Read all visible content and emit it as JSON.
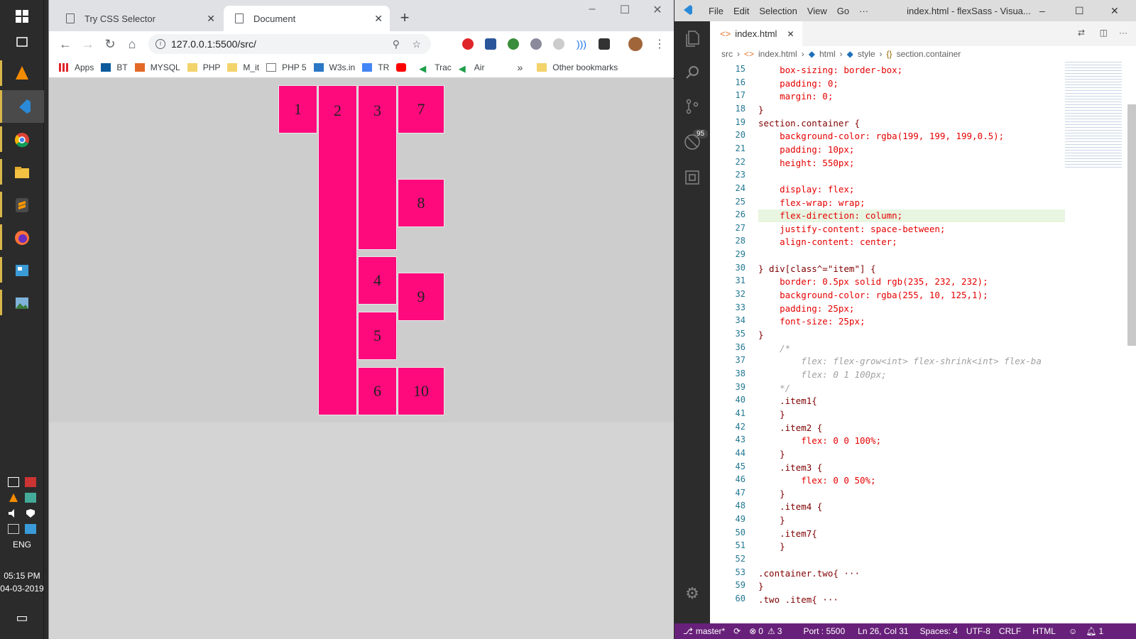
{
  "taskbar": {
    "lang": "ENG",
    "time": "05:15 PM",
    "date": "04-03-2019"
  },
  "chrome": {
    "tabs": [
      {
        "title": "Try CSS Selector"
      },
      {
        "title": "Document"
      }
    ],
    "url": "127.0.0.1:5500/src/",
    "bookmarks": [
      "Apps",
      "BT",
      "MYSQL",
      "PHP",
      "M_it",
      "PHP 5",
      "W3s.in",
      "TR",
      "",
      "Trac",
      "Air"
    ],
    "other_bookmarks": "Other bookmarks",
    "overflow": "»"
  },
  "page": {
    "items": [
      "1",
      "2",
      "3",
      "7",
      "8",
      "4",
      "9",
      "5",
      "6",
      "10"
    ],
    "colors": {
      "item_bg": "#ff0a7d",
      "container_bg": "#cdcdcd"
    }
  },
  "vscode": {
    "menu": [
      "File",
      "Edit",
      "Selection",
      "View",
      "Go",
      "···"
    ],
    "title": "index.html - flexSass - Visua...",
    "tab": "index.html",
    "breadcrumb": [
      "src",
      "index.html",
      "html",
      "style",
      "section.container"
    ],
    "scm_badge": "95",
    "lines": [
      {
        "n": "15",
        "t": "    box-sizing: border-box;"
      },
      {
        "n": "16",
        "t": "    padding: 0;"
      },
      {
        "n": "17",
        "t": "    margin: 0;"
      },
      {
        "n": "18",
        "t": "}"
      },
      {
        "n": "19",
        "t": "section.container {"
      },
      {
        "n": "20",
        "t": "    background-color: rgba(199, 199, 199,0.5);"
      },
      {
        "n": "21",
        "t": "    padding: 10px;"
      },
      {
        "n": "22",
        "t": "    height: 550px;"
      },
      {
        "n": "23",
        "t": ""
      },
      {
        "n": "24",
        "t": "    display: flex;"
      },
      {
        "n": "25",
        "t": "    flex-wrap: wrap;"
      },
      {
        "n": "26",
        "t": "    flex-direction: column;"
      },
      {
        "n": "27",
        "t": "    justify-content: space-between;"
      },
      {
        "n": "28",
        "t": "    align-content: center;"
      },
      {
        "n": "29",
        "t": ""
      },
      {
        "n": "30",
        "t": "} div[class^=\"item\"] {"
      },
      {
        "n": "31",
        "t": "    border: 0.5px solid rgb(235, 232, 232);"
      },
      {
        "n": "32",
        "t": "    background-color: rgba(255, 10, 125,1);"
      },
      {
        "n": "33",
        "t": "    padding: 25px;"
      },
      {
        "n": "34",
        "t": "    font-size: 25px;"
      },
      {
        "n": "35",
        "t": "}"
      },
      {
        "n": "36",
        "t": "    /*"
      },
      {
        "n": "37",
        "t": "        flex: flex-grow<int> flex-shrink<int> flex-ba"
      },
      {
        "n": "38",
        "t": "        flex: 0 1 100px;"
      },
      {
        "n": "39",
        "t": "    */"
      },
      {
        "n": "40",
        "t": "    .item1{"
      },
      {
        "n": "41",
        "t": "    }"
      },
      {
        "n": "42",
        "t": "    .item2 {"
      },
      {
        "n": "43",
        "t": "        flex: 0 0 100%;"
      },
      {
        "n": "44",
        "t": "    }"
      },
      {
        "n": "45",
        "t": "    .item3 {"
      },
      {
        "n": "46",
        "t": "        flex: 0 0 50%;"
      },
      {
        "n": "47",
        "t": "    }"
      },
      {
        "n": "48",
        "t": "    .item4 {"
      },
      {
        "n": "49",
        "t": "    }"
      },
      {
        "n": "50",
        "t": "    .item7{"
      },
      {
        "n": "51",
        "t": "    }"
      },
      {
        "n": "52",
        "t": ""
      },
      {
        "n": "53",
        "t": ".container.two{ ···"
      },
      {
        "n": "59",
        "t": "}"
      },
      {
        "n": "60",
        "t": ".two .item{ ···"
      }
    ],
    "status": {
      "branch": "master*",
      "errors": "0",
      "warnings": "3",
      "port": "Port : 5500",
      "position": "Ln 26, Col 31",
      "spaces": "Spaces: 4",
      "encoding": "UTF-8",
      "eol": "CRLF",
      "language": "HTML",
      "notifications": "1"
    },
    "colors": {
      "statusbar": "#68217a"
    }
  }
}
